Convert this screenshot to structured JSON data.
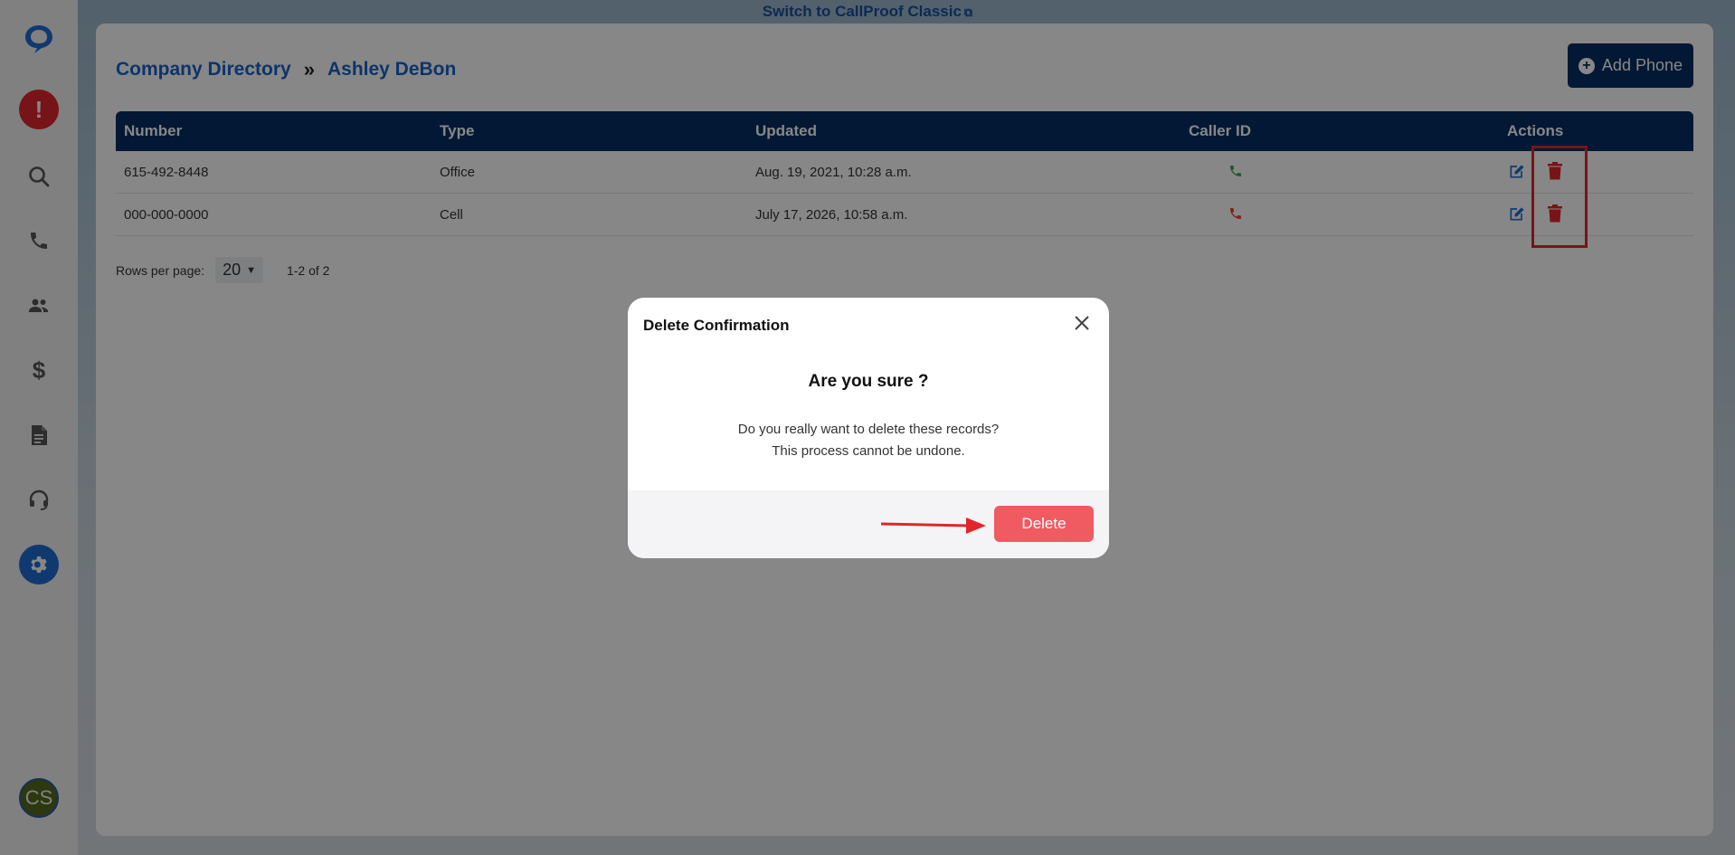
{
  "top_link": {
    "text": "Switch to CallProof Classic"
  },
  "sidebar": {
    "items": [
      {
        "name": "logo"
      },
      {
        "name": "alerts"
      },
      {
        "name": "search"
      },
      {
        "name": "calls"
      },
      {
        "name": "contacts"
      },
      {
        "name": "sales"
      },
      {
        "name": "documents"
      },
      {
        "name": "support"
      },
      {
        "name": "settings"
      }
    ],
    "avatar_initials": "CS"
  },
  "breadcrumb": {
    "root": "Company Directory",
    "separator": "»",
    "current": "Ashley DeBon"
  },
  "add_phone_label": "Add Phone",
  "table": {
    "headers": [
      "Number",
      "Type",
      "Updated",
      "Caller ID",
      "Actions"
    ],
    "rows": [
      {
        "number": "615-492-8448",
        "type": "Office",
        "updated": "Aug. 19, 2021, 10:28 a.m.",
        "caller_id_color": "#34a853"
      },
      {
        "number": "000-000-0000",
        "type": "Cell",
        "updated": "July 17, 2026, 10:58 a.m.",
        "caller_id_color": "#ea4335"
      }
    ]
  },
  "pager": {
    "rows_label": "Rows per page:",
    "rows_value": "20",
    "range": "1-2 of 2"
  },
  "modal": {
    "title": "Delete Confirmation",
    "heading": "Are you sure ?",
    "body_line1": "Do you really want to delete these records?",
    "body_line2": "This process cannot be undone.",
    "delete_label": "Delete"
  },
  "colors": {
    "brand_navy": "#052e63",
    "link_blue": "#1a62c9",
    "danger": "#f05a61",
    "highlight": "#e0262c"
  }
}
